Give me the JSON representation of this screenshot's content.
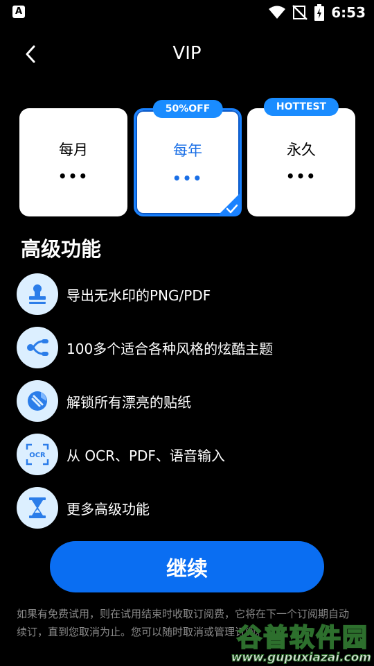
{
  "status_bar": {
    "time": "6:53",
    "left_icon": "A"
  },
  "app_bar": {
    "title": "VIP"
  },
  "plans": [
    {
      "name": "每月",
      "price": "•••",
      "badge": "",
      "selected": false
    },
    {
      "name": "每年",
      "price": "•••",
      "badge": "50%OFF",
      "selected": true
    },
    {
      "name": "永久",
      "price": "•••",
      "badge": "HOTTEST",
      "selected": false
    }
  ],
  "features_title": "高级功能",
  "features": [
    {
      "icon": "stamp-icon",
      "label": "导出无水印的PNG/PDF"
    },
    {
      "icon": "theme-icon",
      "label": "100多个适合各种风格的炫酷主题"
    },
    {
      "icon": "sticker-icon",
      "label": "解锁所有漂亮的贴纸"
    },
    {
      "icon": "ocr-icon",
      "label": "从 OCR、PDF、语音输入"
    },
    {
      "icon": "hourglass-icon",
      "label": "更多高级功能"
    }
  ],
  "continue_label": "继续",
  "fineprint": "如果有免费试用，则在试用结束时收取订阅费，它将在下一个订阅期自动续订，直到您取消为止。您可以随时取消或管理订阅。",
  "watermark": {
    "top": "谷普软件园",
    "bottom": "www.gupuxiazai.com"
  },
  "colors": {
    "accent": "#0a6ef2",
    "badge": "#1a8cff",
    "icon_bg": "#dcefff"
  }
}
